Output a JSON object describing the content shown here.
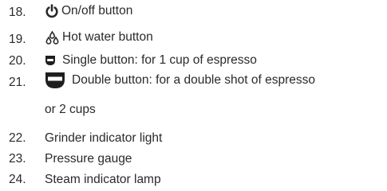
{
  "items": [
    {
      "num": "18.",
      "icon": "power-icon",
      "text": "On/off button"
    },
    {
      "num": "19.",
      "icon": "water-drops-icon",
      "text": "Hot water button"
    },
    {
      "num": "20.",
      "icon": "single-cup-icon",
      "text": "Single button: for 1 cup of espresso"
    },
    {
      "num": "21.",
      "icon": "double-cup-icon",
      "text": "Double button: for a double shot of espresso",
      "text_cont": "or 2 cups"
    },
    {
      "num": "22.",
      "icon": "",
      "text": "Grinder indicator light"
    },
    {
      "num": "23.",
      "icon": "",
      "text": "Pressure gauge"
    },
    {
      "num": "24.",
      "icon": "",
      "text": "Steam indicator lamp"
    }
  ]
}
